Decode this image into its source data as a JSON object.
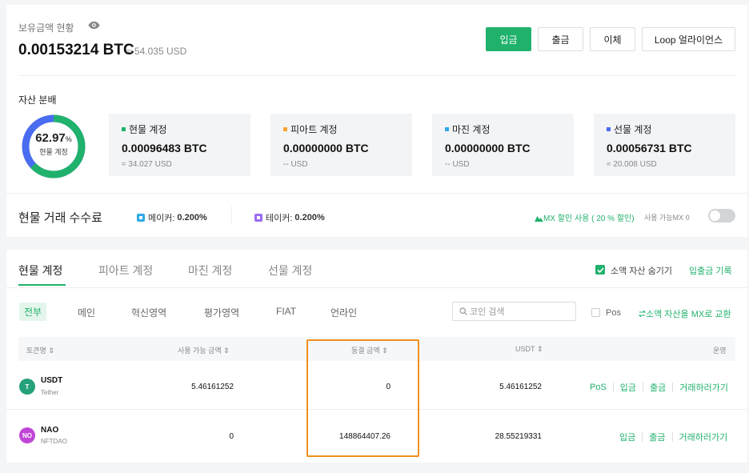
{
  "balance": {
    "label": "보유금액 현황",
    "value": "0.00153214 BTC",
    "usd": "≈ 54.035 USD"
  },
  "actions": {
    "deposit": "입금",
    "withdraw": "출금",
    "transfer": "이체",
    "loop": "Loop 얼라이언스"
  },
  "distribution": {
    "title": "자산 분배",
    "percent": "62.97",
    "percent_sign": "%",
    "donut_label": "현물 계정",
    "spot_fraction": 0.6297,
    "colors": {
      "spot": "#20b26c",
      "futures": "#4a6cf0"
    }
  },
  "accounts": [
    {
      "name": "현물 계정",
      "value": "0.00096483 BTC",
      "usd": "≈ 34.027 USD",
      "color": "#20b26c"
    },
    {
      "name": "피아트 계정",
      "value": "0.00000000 BTC",
      "usd": "-- USD",
      "color": "#f7a531"
    },
    {
      "name": "마진 계정",
      "value": "0.00000000 BTC",
      "usd": "-- USD",
      "color": "#2fa8e8"
    },
    {
      "name": "선물 계정",
      "value": "0.00056731 BTC",
      "usd": "≈ 20.008 USD",
      "color": "#4a6cf0"
    }
  ],
  "fees": {
    "title": "현물 거래 수수료",
    "maker_label": "메이커:",
    "maker_value": "0.200%",
    "maker_color": "#2fa8e8",
    "taker_label": "테이커:",
    "taker_value": "0.200%",
    "taker_color": "#9b6cf0",
    "mx_discount": "MX 할인 사용 ( 20 % 할인)",
    "mx_available": "사용 가능MX 0",
    "toggle_on": false
  },
  "tabs": [
    "현물 계정",
    "피아트 계정",
    "마진 계정",
    "선물 계정"
  ],
  "hide_small": "소액 자산 숨기기",
  "deposit_history": "입출금 기록",
  "filters": [
    "전부",
    "메인",
    "혁신영역",
    "평가영역",
    "FIAT",
    "언라인"
  ],
  "search_placeholder": "코인 검색",
  "pos_label": "Pos",
  "convert_link": "소액 자산을 MX로 교환",
  "columns": {
    "token": "토큰명 ⇕",
    "available": "사용 가능 금액 ⇕",
    "frozen": "동결 금액 ⇕",
    "usdt": "USDT ⇕",
    "ops": "운영"
  },
  "rows": [
    {
      "symbol": "USDT",
      "name": "Tether",
      "icon": "T",
      "icon_color": "#26a17b",
      "available": "5.46161252",
      "frozen": "0",
      "usdt": "5.46161252",
      "actions": [
        "PoS",
        "입금",
        "출금",
        "거래하러가기"
      ]
    },
    {
      "symbol": "NAO",
      "name": "NFTDAO",
      "icon": "NO",
      "icon_color": "#c046d6",
      "available": "0",
      "frozen": "148864407.26",
      "usdt": "28.55219331",
      "actions": [
        "입금",
        "출금",
        "거래하러가기"
      ]
    }
  ]
}
